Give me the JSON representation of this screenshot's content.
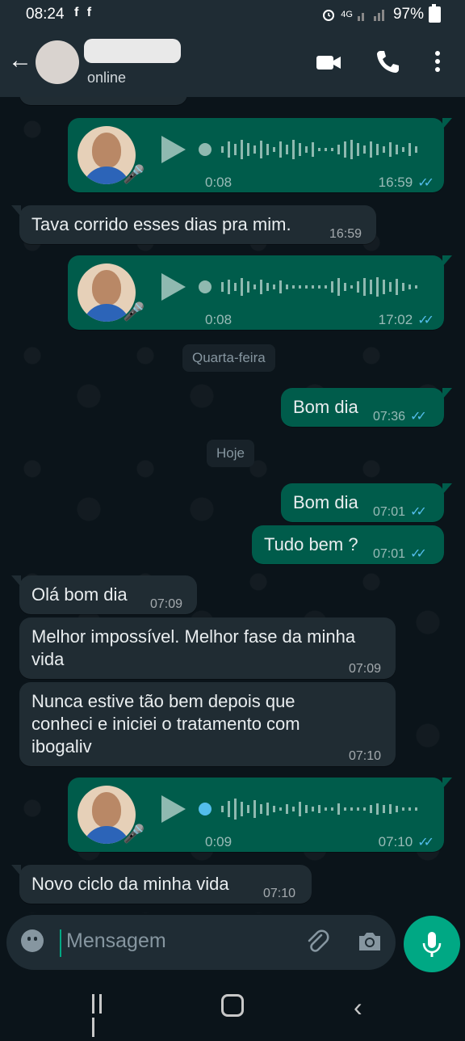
{
  "status_bar": {
    "time": "08:24",
    "left_icons": "f f",
    "network": "4G",
    "battery": "97%"
  },
  "header": {
    "presence": "online"
  },
  "chat": {
    "voice_1": {
      "duration": "0:08",
      "time": "16:59"
    },
    "msg_1": {
      "text": "Tava corrido esses dias pra mim.",
      "time": "16:59"
    },
    "voice_2": {
      "duration": "0:08",
      "time": "17:02"
    },
    "date_1": "Quarta-feira",
    "msg_2": {
      "text": "Bom dia",
      "time": "07:36"
    },
    "date_2": "Hoje",
    "msg_3": {
      "text": "Bom dia",
      "time": "07:01"
    },
    "msg_4": {
      "text": "Tudo bem ?",
      "time": "07:01"
    },
    "msg_5": {
      "text": "Olá bom dia",
      "time": "07:09"
    },
    "msg_6": {
      "line1": "Melhor impossível. Melhor fase da minha",
      "line2": "vida",
      "time": "07:09"
    },
    "msg_7": {
      "line1": "Nunca estive tão bem depois que",
      "line2": "conheci e iniciei o tratamento com",
      "line3": "ibogaliv",
      "time": "07:10"
    },
    "voice_3": {
      "duration": "0:09",
      "time": "07:10"
    },
    "msg_8": {
      "text": "Novo ciclo da minha vida",
      "time": "07:10"
    },
    "read_ticks": "✓✓"
  },
  "composer": {
    "placeholder": "Mensagem"
  },
  "colors": {
    "outgoing": "#005c4b",
    "incoming": "#202c33",
    "accent": "#00a884",
    "read": "#53bdeb"
  },
  "icons": [
    "back-arrow-icon",
    "video-call-icon",
    "phone-icon",
    "menu-dots-icon",
    "play-icon",
    "mic-icon",
    "emoji-icon",
    "attach-icon",
    "camera-icon"
  ]
}
